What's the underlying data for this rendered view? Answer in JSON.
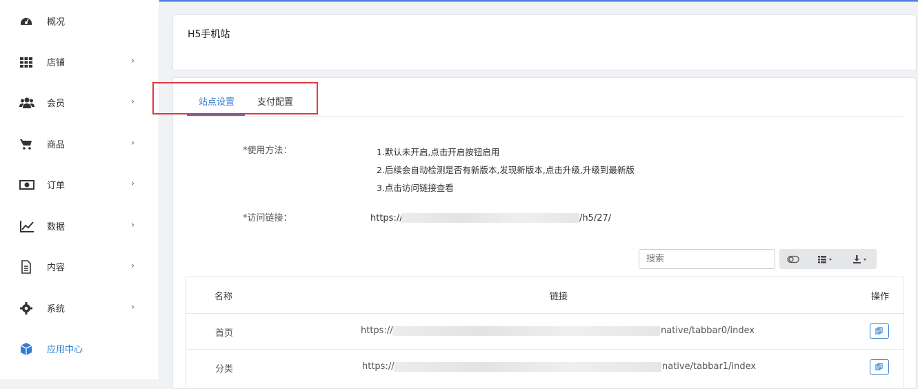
{
  "sidebar": {
    "items": [
      {
        "label": "概况",
        "icon": "dashboard-icon",
        "has_chevron": false
      },
      {
        "label": "店铺",
        "icon": "grid-icon",
        "has_chevron": true
      },
      {
        "label": "会员",
        "icon": "users-icon",
        "has_chevron": true
      },
      {
        "label": "商品",
        "icon": "cart-icon",
        "has_chevron": true
      },
      {
        "label": "订单",
        "icon": "money-icon",
        "has_chevron": true
      },
      {
        "label": "数据",
        "icon": "chart-line-icon",
        "has_chevron": true
      },
      {
        "label": "内容",
        "icon": "document-icon",
        "has_chevron": true
      },
      {
        "label": "系统",
        "icon": "gear-icon",
        "has_chevron": true
      },
      {
        "label": "应用中心",
        "icon": "cube-icon",
        "has_chevron": false,
        "active": true
      }
    ],
    "chevron": "›"
  },
  "header": {
    "title": "H5手机站"
  },
  "tabs": [
    {
      "label": "站点设置",
      "active": true
    },
    {
      "label": "支付配置",
      "active": false
    }
  ],
  "form": {
    "usage_label": "*使用方法：",
    "usage_lines": [
      "1.默认未开启,点击开启按钮启用",
      "2.后续会自动检测是否有新版本,发现新版本,点击升级,升级到最新版",
      "3.点击访问链接查看"
    ],
    "link_label": "*访问链接：",
    "link_prefix": "https://",
    "link_suffix": "/h5/27/"
  },
  "toolbar": {
    "search_placeholder": "搜索",
    "toggle_icon": "toggle-icon",
    "columns_icon": "columns-icon",
    "export_icon": "download-icon"
  },
  "table": {
    "headers": [
      "名称",
      "链接",
      "操作"
    ],
    "rows": [
      {
        "name": "首页",
        "link_prefix": "https://",
        "link_suffix": "native/tabbar0/index"
      },
      {
        "name": "分类",
        "link_prefix": "https://",
        "link_suffix": "native/tabbar1/index"
      }
    ]
  },
  "colors": {
    "accent": "#2f7fd6",
    "highlight_box": "#e0393e"
  }
}
